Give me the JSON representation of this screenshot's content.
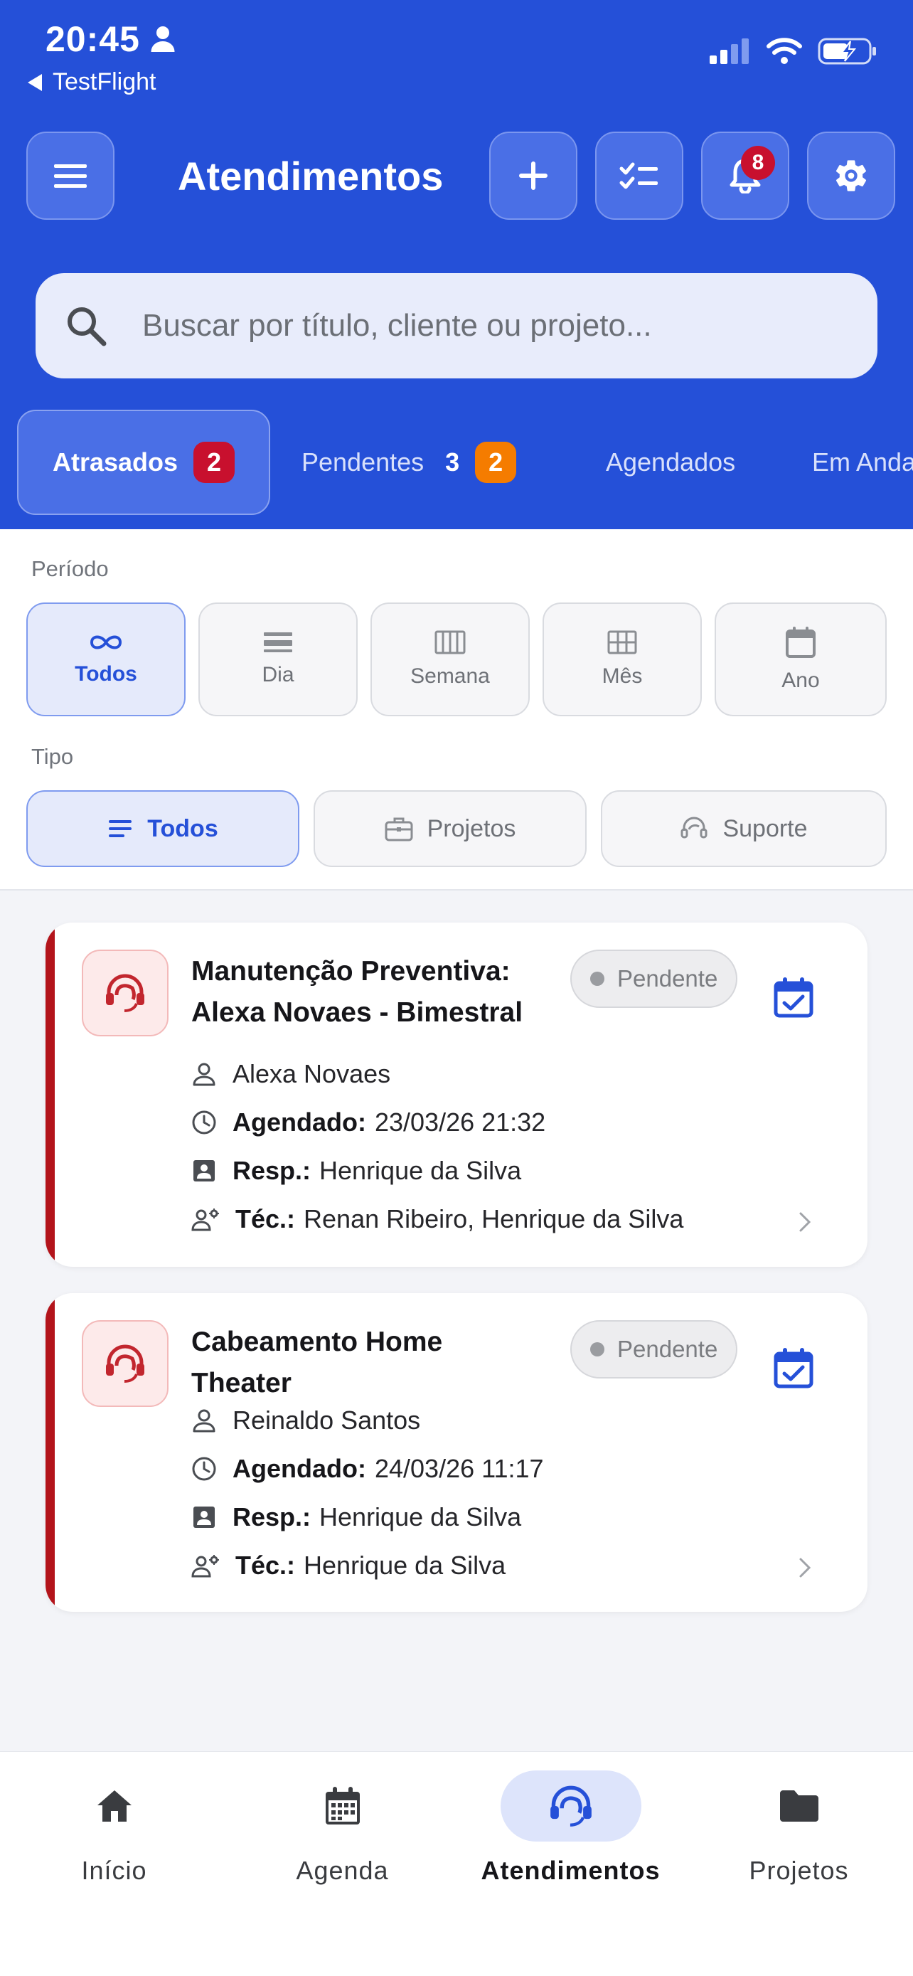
{
  "status_bar": {
    "time": "20:45",
    "back_app": "TestFlight"
  },
  "app_bar": {
    "title": "Atendimentos",
    "notification_count": "8"
  },
  "search": {
    "placeholder": "Buscar por título, cliente ou projeto..."
  },
  "tabs": [
    {
      "label": "Atrasados",
      "badge": "2"
    },
    {
      "label": "Pendentes",
      "count": "3",
      "badge": "2"
    },
    {
      "label": "Agendados"
    },
    {
      "label": "Em Anda"
    }
  ],
  "filters": {
    "period_label": "Período",
    "period_options": [
      "Todos",
      "Dia",
      "Semana",
      "Mês",
      "Ano"
    ],
    "period_selected": "Todos",
    "type_label": "Tipo",
    "type_options": [
      "Todos",
      "Projetos",
      "Suporte"
    ],
    "type_selected": "Todos"
  },
  "labels": {
    "scheduled": "Agendado:",
    "responsible": "Resp.:",
    "technicians": "Téc.:"
  },
  "cards": [
    {
      "title": "Manutenção Preventiva: Alexa Novaes - Bimestral",
      "status": "Pendente",
      "client": "Alexa Novaes",
      "scheduled": "23/03/26 21:32",
      "responsible": "Henrique da Silva",
      "technicians": "Renan Ribeiro, Henrique da Silva"
    },
    {
      "title": "Cabeamento Home Theater",
      "status": "Pendente",
      "client": "Reinaldo Santos",
      "scheduled": "24/03/26 11:17",
      "responsible": "Henrique da Silva",
      "technicians": "Henrique da Silva"
    }
  ],
  "bottom_nav": [
    {
      "label": "Início"
    },
    {
      "label": "Agenda"
    },
    {
      "label": "Atendimentos",
      "active": true
    },
    {
      "label": "Projetos"
    }
  ],
  "colors": {
    "primary": "#2550d8",
    "danger": "#b3141b",
    "warning": "#f57c00"
  }
}
